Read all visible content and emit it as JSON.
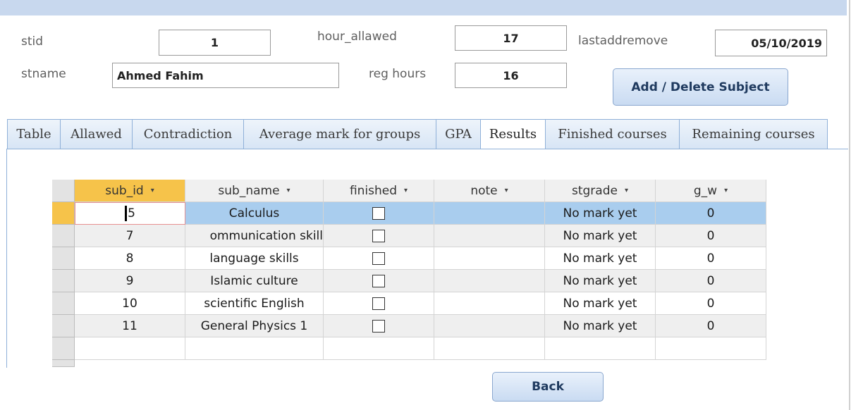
{
  "header": {
    "stid_label": "stid",
    "stid_value": "1",
    "stname_label": "stname",
    "stname_value": "Ahmed Fahim",
    "hour_allawed_label": "hour_allawed",
    "hour_allawed_value": "17",
    "reg_hours_label": "reg hours",
    "reg_hours_value": "16",
    "lastaddremove_label": "lastaddremove",
    "lastaddremove_value": "05/10/2019",
    "add_delete_label": "Add / Delete Subject"
  },
  "tabs": [
    "Table",
    "Allawed",
    "Contradiction",
    "Average mark for groups",
    "GPA",
    "Results",
    "Finished courses",
    "Remaining courses"
  ],
  "active_tab": "Results",
  "table": {
    "columns": [
      "sub_id",
      "sub_name",
      "finished",
      "note",
      "stgrade",
      "g_w"
    ],
    "rows": [
      {
        "sub_id": "5",
        "sub_name": "Calculus",
        "finished": false,
        "note": "",
        "stgrade": "No mark yet",
        "g_w": "0"
      },
      {
        "sub_id": "7",
        "sub_name": "ommunication skill",
        "finished": false,
        "note": "",
        "stgrade": "No mark yet",
        "g_w": "0"
      },
      {
        "sub_id": "8",
        "sub_name": "language skills",
        "finished": false,
        "note": "",
        "stgrade": "No mark yet",
        "g_w": "0"
      },
      {
        "sub_id": "9",
        "sub_name": "Islamic culture",
        "finished": false,
        "note": "",
        "stgrade": "No mark yet",
        "g_w": "0"
      },
      {
        "sub_id": "10",
        "sub_name": "scientific English",
        "finished": false,
        "note": "",
        "stgrade": "No mark yet",
        "g_w": "0"
      },
      {
        "sub_id": "11",
        "sub_name": "General Physics 1",
        "finished": false,
        "note": "",
        "stgrade": "No mark yet",
        "g_w": "0"
      }
    ]
  },
  "footer": {
    "back_label": "Back"
  },
  "colors": {
    "accent_header": "#f6c34a",
    "selected_row": "#a9cdee",
    "button": "#c9dbf2"
  }
}
